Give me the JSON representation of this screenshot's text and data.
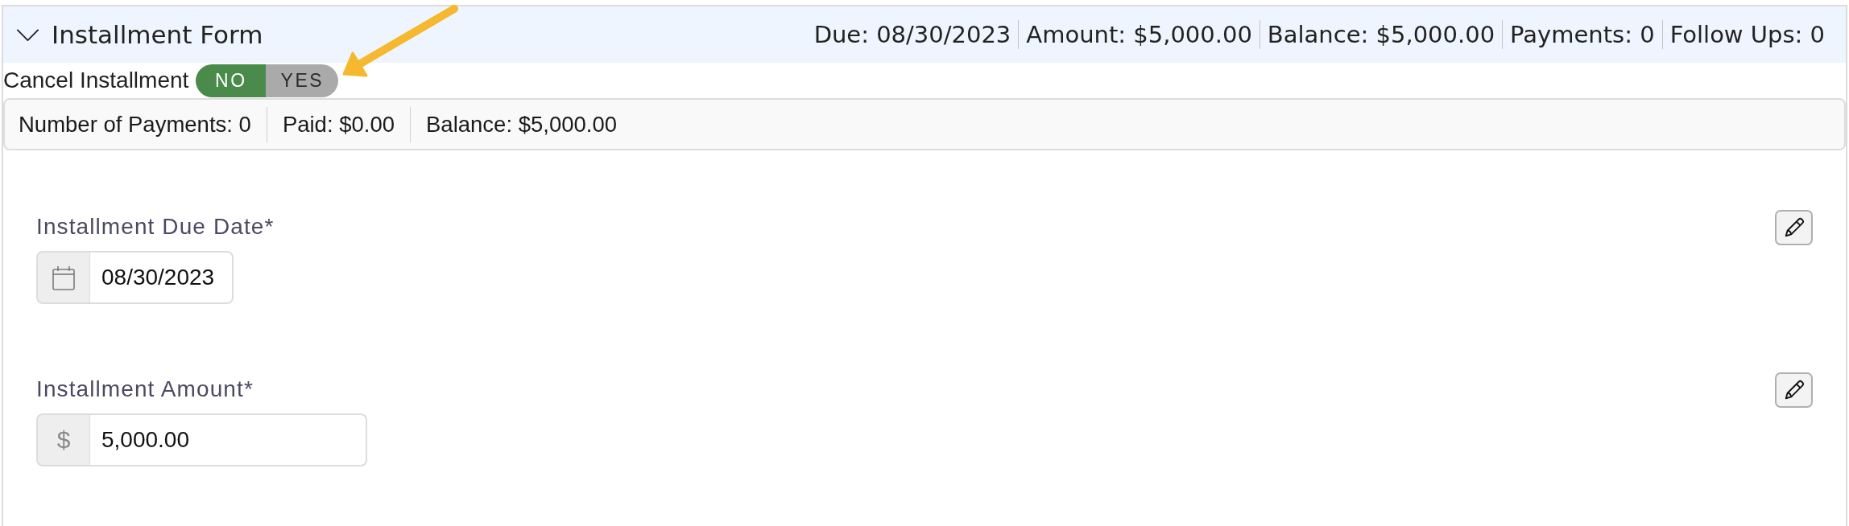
{
  "panel": {
    "title": "Installment Form",
    "expanded": true,
    "summary": [
      "Due: 08/30/2023",
      "Amount: $5,000.00",
      "Balance: $5,000.00",
      "Payments: 0",
      "Follow Ups: 0"
    ]
  },
  "cancel_toggle": {
    "label": "Cancel Installment",
    "options": [
      {
        "label": "NO",
        "selected": true
      },
      {
        "label": "YES",
        "selected": false
      }
    ]
  },
  "stats": [
    "Number of Payments: 0",
    "Paid: $0.00",
    "Balance: $5,000.00"
  ],
  "fields": [
    {
      "kind": "date",
      "label": "Installment Due Date*",
      "value": "08/30/2023"
    },
    {
      "kind": "currency",
      "label": "Installment Amount*",
      "addon": "$",
      "value": "5,000.00"
    }
  ]
}
